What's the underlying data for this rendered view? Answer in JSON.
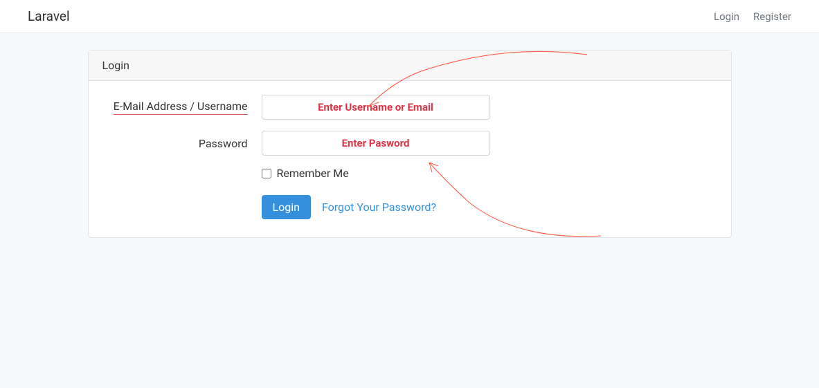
{
  "navbar": {
    "brand": "Laravel",
    "login_link": "Login",
    "register_link": "Register"
  },
  "card": {
    "title": "Login"
  },
  "form": {
    "email_label": "E-Mail Address / Username",
    "email_placeholder": "Enter Username or Email",
    "password_label": "Password",
    "password_placeholder": "Enter Pasword",
    "remember_label": "Remember Me",
    "submit_label": "Login",
    "forgot_link": "Forgot Your Password?"
  },
  "colors": {
    "annotation": "#ff5a45",
    "link": "#3490dc",
    "danger": "#dc3545"
  }
}
